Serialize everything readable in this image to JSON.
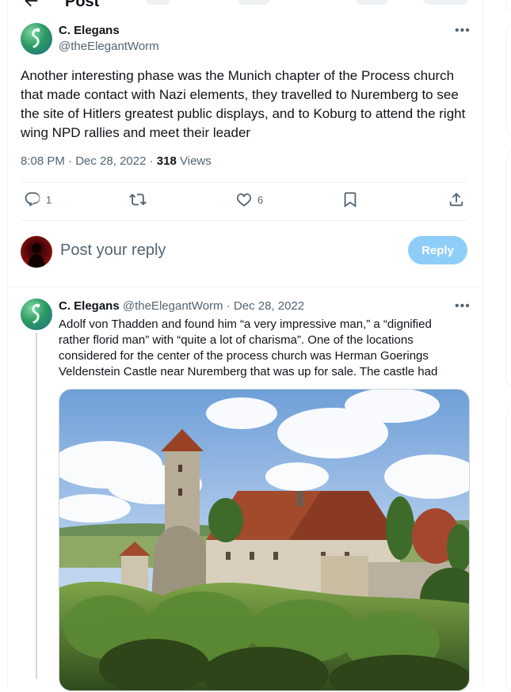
{
  "header": {
    "title": "Post",
    "back_icon": "arrow-left-icon"
  },
  "tweet": {
    "author_name": "C. Elegans",
    "author_handle": "@theElegantWorm",
    "text": "Another interesting phase was the Munich chapter of the Process church that made contact with Nazi elements, they travelled to Nuremberg to see the site of Hitlers greatest public displays, and to Koburg to attend the right wing NPD rallies and meet their leader",
    "time": "8:08 PM",
    "date": "Dec 28, 2022",
    "views_count": "318",
    "views_label": "Views",
    "actions": {
      "reply_count": "1",
      "retweet_count": "",
      "like_count": "6"
    }
  },
  "composer": {
    "placeholder": "Post your reply",
    "button_label": "Reply"
  },
  "reply": {
    "author_name": "C. Elegans",
    "author_handle": "@theElegantWorm",
    "date": "Dec 28, 2022",
    "text": "Adolf von Thadden and found him “a very impressive man,” a “dignified rather florid man” with “quite a lot of charisma”. One of the locations considered for the center of the process church was Herman Goerings Veldenstein Castle near Nuremberg that was up for sale. The castle had"
  },
  "colors": {
    "accent": "#1d9bf0",
    "reply_button_disabled": "#8ecdf8",
    "secondary_text": "#536471"
  }
}
